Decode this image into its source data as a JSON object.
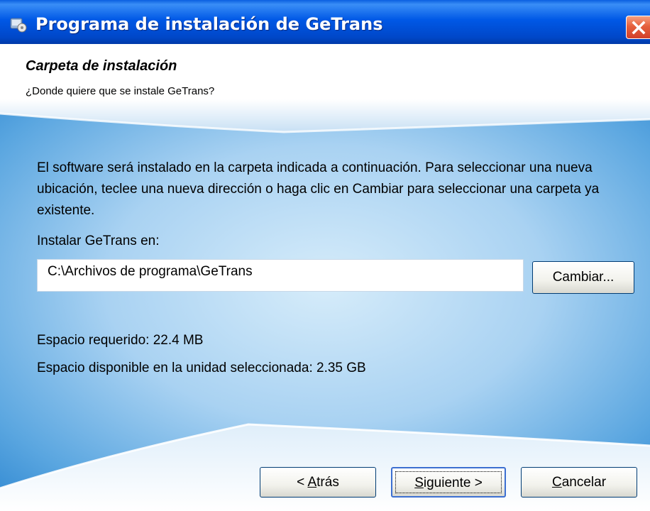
{
  "window": {
    "title": "Programa de instalación de GeTrans"
  },
  "header": {
    "title": "Carpeta de instalación",
    "subtitle": "¿Donde quiere que se instale GeTrans?"
  },
  "main": {
    "description": "El software será instalado en la carpeta indicada a continuación. Para seleccionar una nueva ubicación, teclee una nueva dirección o haga clic en Cambiar para seleccionar una carpeta ya existente.",
    "install_label": "Instalar GeTrans en:",
    "install_path": "C:\\Archivos de programa\\GeTrans",
    "change_button": "Cambiar...",
    "space_required": "Espacio requerido: 22.4 MB",
    "space_available": "Espacio disponible en la unidad seleccionada: 2.35 GB"
  },
  "footer": {
    "back_prefix": "< ",
    "back_mnemonic": "A",
    "back_rest": "trás",
    "next_mnemonic": "S",
    "next_rest": "iguiente >",
    "cancel_mnemonic": "C",
    "cancel_rest": "ancelar"
  },
  "colors": {
    "titlebar": "#0058e6",
    "body_blue": "#5aa6e0",
    "close_button": "#e5603c"
  },
  "icons": {
    "title_icon": "installer-icon",
    "close_icon": "close-icon"
  }
}
